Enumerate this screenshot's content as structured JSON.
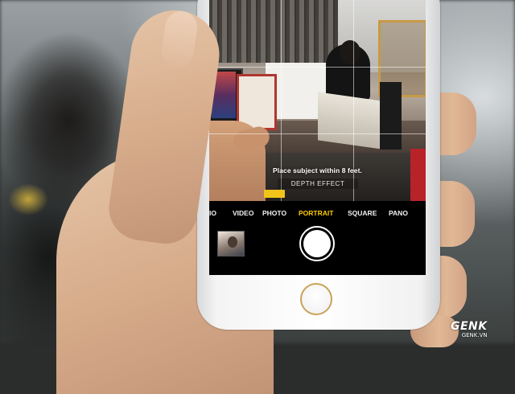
{
  "camera": {
    "hint_text": "Place subject within 8 feet.",
    "depth_effect_label": "DEPTH EFFECT",
    "modes": [
      {
        "label": "IO",
        "active": false
      },
      {
        "label": "VIDEO",
        "active": false
      },
      {
        "label": "PHOTO",
        "active": false
      },
      {
        "label": "PORTRAIT",
        "active": true
      },
      {
        "label": "SQUARE",
        "active": false
      },
      {
        "label": "PANO",
        "active": false
      }
    ],
    "active_mode_color": "#ffcc00",
    "depth_indicator_color": "#f0c419",
    "icons": {
      "shutter": "shutter-button",
      "last_photo": "photo-thumbnail",
      "home": "home-button"
    }
  },
  "device": {
    "body_color": "#f4f4f4",
    "home_ring_color": "#c9a35a"
  },
  "watermark": {
    "logo": "GENK",
    "site": "GENK.VN"
  }
}
